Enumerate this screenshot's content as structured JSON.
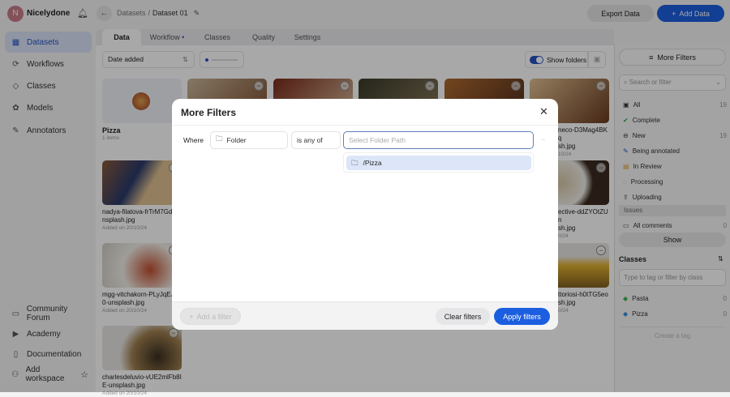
{
  "workspace": {
    "avatar_letter": "N",
    "name": "Nicelydone"
  },
  "breadcrumb": {
    "parent": "Datasets",
    "separator": "/",
    "current": "Dataset 01"
  },
  "header": {
    "export_label": "Export Data",
    "add_label": "Add Data"
  },
  "sidebar": {
    "items": [
      {
        "label": "Datasets",
        "icon": "grid-icon"
      },
      {
        "label": "Workflows",
        "icon": "workflow-icon"
      },
      {
        "label": "Classes",
        "icon": "tag-icon"
      },
      {
        "label": "Models",
        "icon": "brain-icon"
      },
      {
        "label": "Annotators",
        "icon": "pencil-icon"
      }
    ],
    "bottom": [
      {
        "label": "Community Forum",
        "icon": "chat-icon"
      },
      {
        "label": "Academy",
        "icon": "play-icon"
      },
      {
        "label": "Documentation",
        "icon": "document-icon"
      },
      {
        "label": "Add workspace",
        "icon": "add-user-icon"
      }
    ]
  },
  "tabs": [
    {
      "label": "Data"
    },
    {
      "label": "Workflow"
    },
    {
      "label": "Classes"
    },
    {
      "label": "Quality"
    },
    {
      "label": "Settings"
    }
  ],
  "toolbar": {
    "sort_label": "Date added",
    "show_folders_label": "Show folders",
    "show_folders_on": true
  },
  "grid": {
    "folder": {
      "name": "Pizza",
      "count": "1 items"
    },
    "files": [
      {
        "name": "nadya-filatova-frTrM7Gdk-unsplash.jpg",
        "date": "Added on 20/10/24"
      },
      {
        "name": "mgg-vitchakorn-PLyJqEJV0-unsplash.jpg",
        "date": "Added on 20/10/24"
      },
      {
        "name": "charlesdeluvio-vUE2mlFb8IE-unsplash.jpg",
        "date": "Added on 20/10/24"
      }
    ],
    "right_col": [
      {
        "name": "neco-D3Mag4BKq",
        "ext": "sh.jpg",
        "date": "10/24"
      },
      {
        "name": "ective-ddZYOtZUn",
        "ext": "sh.jpg",
        "date": "0/24"
      },
      {
        "name": "ttoriosi-h0tTG5eo",
        "ext": "sh.jpg",
        "date": "0/24"
      }
    ]
  },
  "filters_panel": {
    "more_filters_label": "More Filters",
    "search_placeholder": "Search or filter",
    "statuses": [
      {
        "label": "All",
        "count": "19"
      },
      {
        "label": "Complete",
        "count": ""
      },
      {
        "label": "New",
        "count": "19"
      },
      {
        "label": "Being annotated",
        "count": ""
      },
      {
        "label": "In Review",
        "count": ""
      },
      {
        "label": "Processing",
        "count": ""
      },
      {
        "label": "Uploading",
        "count": ""
      }
    ],
    "issues_label": "Issues",
    "comments": {
      "label": "All comments",
      "count": "0"
    },
    "show_label": "Show",
    "classes_title": "Classes",
    "class_placeholder": "Type to tag or filter by class",
    "classes": [
      {
        "label": "Pasta",
        "count": "0",
        "color": "#3cb54a"
      },
      {
        "label": "Pizza",
        "count": "0",
        "color": "#3a8fd8"
      }
    ],
    "create_tag_label": "Create a tag"
  },
  "modal": {
    "title": "More Filters",
    "where_label": "Where",
    "field_label": "Folder",
    "operator_label": "is any of",
    "value_placeholder": "Select Folder Path",
    "options": [
      {
        "label": "/Pizza"
      }
    ],
    "add_filter_label": "Add a filter",
    "clear_label": "Clear filters",
    "apply_label": "Apply filters"
  },
  "colors": {
    "accent": "#1c5ee0"
  }
}
